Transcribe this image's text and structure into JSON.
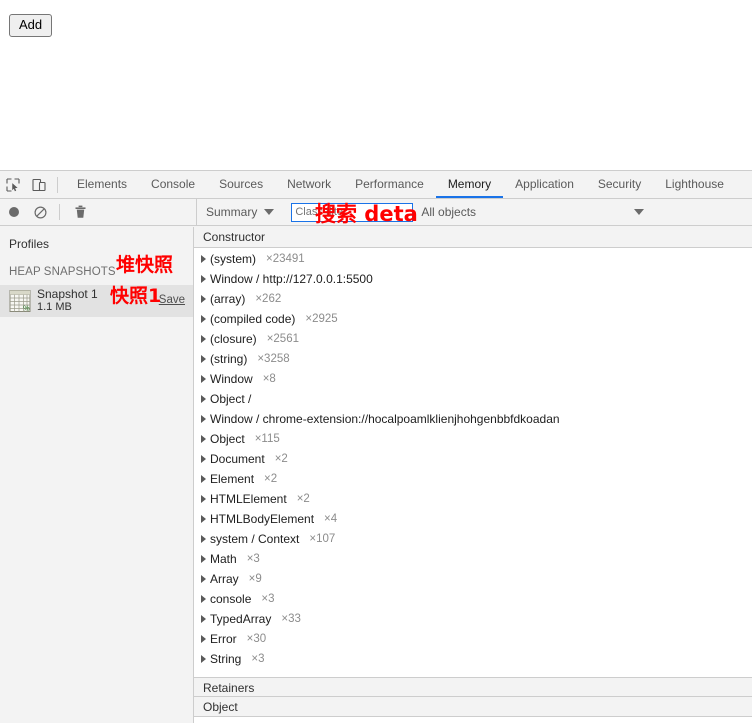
{
  "page": {
    "add_button_label": "Add"
  },
  "devtools": {
    "toolbar_icons": [
      {
        "name": "inspect-element-icon"
      },
      {
        "name": "device-toolbar-icon"
      }
    ],
    "tabs": [
      {
        "label": "Elements",
        "active": false
      },
      {
        "label": "Console",
        "active": false
      },
      {
        "label": "Sources",
        "active": false
      },
      {
        "label": "Network",
        "active": false
      },
      {
        "label": "Performance",
        "active": false
      },
      {
        "label": "Memory",
        "active": true
      },
      {
        "label": "Application",
        "active": false
      },
      {
        "label": "Security",
        "active": false
      },
      {
        "label": "Lighthouse",
        "active": false
      }
    ],
    "actionbar": {
      "record_icon": "record-heap-snapshot-icon",
      "clear_icon": "clear-icon",
      "delete_icon": "trash-icon",
      "view_select_value": "Summary",
      "class_filter_placeholder": "Class filter",
      "class_filter_value": "",
      "objects_select_value": "All objects"
    },
    "sidebar": {
      "profiles_label": "Profiles",
      "heap_snapshots_label": "HEAP SNAPSHOTS",
      "snapshot": {
        "name": "Snapshot 1",
        "size": "1.1 MB",
        "save_label": "Save",
        "icon": "heap-snapshot-icon"
      }
    },
    "summary": {
      "column_header": "Constructor",
      "rows": [
        {
          "constructor": "(system)",
          "count": "×23491"
        },
        {
          "constructor": "Window / http://127.0.0.1:5500",
          "count": ""
        },
        {
          "constructor": "(array)",
          "count": "×262"
        },
        {
          "constructor": "(compiled code)",
          "count": "×2925"
        },
        {
          "constructor": "(closure)",
          "count": "×2561"
        },
        {
          "constructor": "(string)",
          "count": "×3258"
        },
        {
          "constructor": "Window",
          "count": "×8"
        },
        {
          "constructor": "Object /",
          "count": ""
        },
        {
          "constructor": "Window / chrome-extension://hocalpoamlklienjhohgenbbfdkoadan",
          "count": ""
        },
        {
          "constructor": "Object",
          "count": "×115"
        },
        {
          "constructor": "Document",
          "count": "×2"
        },
        {
          "constructor": "Element",
          "count": "×2"
        },
        {
          "constructor": "HTMLElement",
          "count": "×2"
        },
        {
          "constructor": "HTMLBodyElement",
          "count": "×4"
        },
        {
          "constructor": "system / Context",
          "count": "×107"
        },
        {
          "constructor": "Math",
          "count": "×3"
        },
        {
          "constructor": "Array",
          "count": "×9"
        },
        {
          "constructor": "console",
          "count": "×3"
        },
        {
          "constructor": "TypedArray",
          "count": "×33"
        },
        {
          "constructor": "Error",
          "count": "×30"
        },
        {
          "constructor": "String",
          "count": "×3"
        }
      ]
    },
    "retainers": {
      "title": "Retainers",
      "column_header": "Object"
    }
  },
  "annotations": {
    "heap_snapshot": "堆快照",
    "snapshot_one": "快照1",
    "search_data": "搜索 deta"
  },
  "colors": {
    "accent": "#1a73e8",
    "annotation": "#ff0000",
    "chrome_bg": "#f3f3f3",
    "border": "#cdcdcd"
  }
}
